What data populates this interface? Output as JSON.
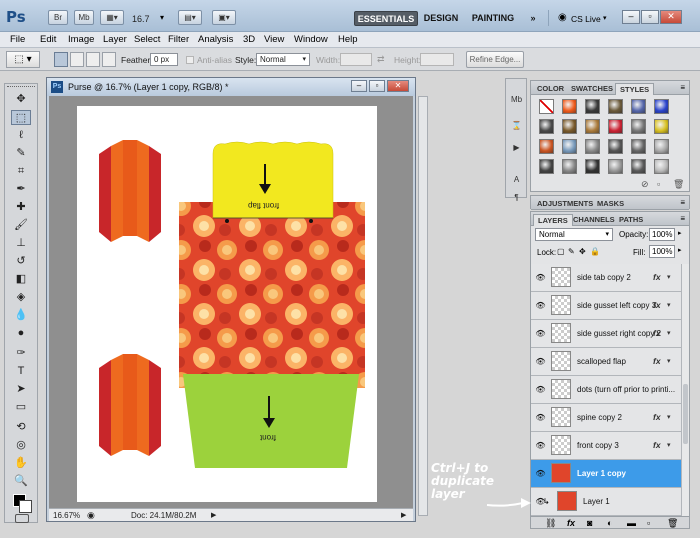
{
  "app": {
    "logo": "Ps",
    "bar_buttons": [
      "Br",
      "Mb"
    ],
    "zoom": "16.7",
    "workspaces": [
      "ESSENTIALS",
      "DESIGN",
      "PAINTING"
    ],
    "more": "»",
    "cs_live": "CS Live"
  },
  "menu": [
    "File",
    "Edit",
    "Image",
    "Layer",
    "Select",
    "Filter",
    "Analysis",
    "3D",
    "View",
    "Window",
    "Help"
  ],
  "options": {
    "feather_label": "Feather:",
    "feather_value": "0 px",
    "antialias": "Anti-alias",
    "style_label": "Style:",
    "style_value": "Normal",
    "width_label": "Width:",
    "height_label": "Height:",
    "refine_edge": "Refine Edge..."
  },
  "document": {
    "title": "Purse @ 16.7% (Layer 1 copy, RGB/8) *",
    "zoom": "16.67%",
    "doc_size": "Doc: 24.1M/80.2M",
    "front_flap_label": "front flap",
    "front_label": "front"
  },
  "swatch_panel": {
    "tabs": [
      "COLOR",
      "SWATCHES",
      "STYLES"
    ],
    "active_tab": "STYLES"
  },
  "adjust_panel": {
    "tabs": [
      "ADJUSTMENTS",
      "MASKS"
    ]
  },
  "layers_panel": {
    "tabs": [
      "LAYERS",
      "CHANNELS",
      "PATHS"
    ],
    "active_tab": "LAYERS",
    "blend_mode": "Normal",
    "opacity_label": "Opacity:",
    "opacity_value": "100%",
    "lock_label": "Lock:",
    "fill_label": "Fill:",
    "fill_value": "100%",
    "layers": [
      {
        "name": "side tab  copy 2",
        "fx": true,
        "selected": false
      },
      {
        "name": "side gusset left copy 3",
        "fx": true,
        "selected": false
      },
      {
        "name": "side gusset right  copy 2",
        "fx": true,
        "selected": false
      },
      {
        "name": "scalloped flap",
        "fx": true,
        "selected": false
      },
      {
        "name": "dots (turn off prior to printi...",
        "fx": false,
        "selected": false
      },
      {
        "name": "spine copy 2",
        "fx": true,
        "selected": false
      },
      {
        "name": "front copy 3",
        "fx": true,
        "selected": false
      },
      {
        "name": "Layer 1 copy",
        "fx": false,
        "selected": true
      },
      {
        "name": "Layer 1",
        "fx": false,
        "selected": false
      }
    ]
  },
  "annotation": "Ctrl+J to duplicate layer",
  "colors": {
    "accent_selected_layer": "#3d9be9",
    "purse_red": "#c8262a",
    "purse_orange": "#ee6a1f",
    "flap_yellow": "#f2e81f",
    "front_green": "#9cd23c",
    "pattern_red": "#e0452b"
  }
}
